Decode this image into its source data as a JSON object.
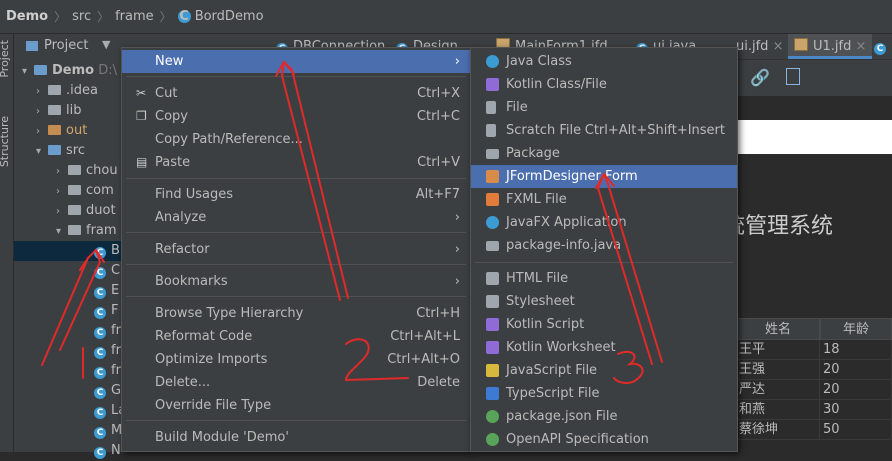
{
  "breadcrumb": {
    "items": [
      "Demo",
      "src",
      "frame",
      "BordDemo"
    ]
  },
  "toolstrip": {
    "project_label": "Project",
    "structure_label": "Structure"
  },
  "project_panel": {
    "title": "Project"
  },
  "tree": [
    {
      "label": "Demo",
      "suffix": "D:\\",
      "type": "module",
      "expanded": true
    },
    {
      "label": ".idea",
      "type": "folder",
      "expanded": false
    },
    {
      "label": "lib",
      "type": "folder",
      "expanded": false
    },
    {
      "label": "out",
      "type": "folder-excluded",
      "expanded": false
    },
    {
      "label": "src",
      "type": "folder-source",
      "expanded": true
    },
    {
      "label": "chou",
      "type": "package",
      "expanded": false
    },
    {
      "label": "com",
      "type": "package",
      "expanded": false
    },
    {
      "label": "duot",
      "type": "package",
      "expanded": false
    },
    {
      "label": "fram",
      "type": "package",
      "expanded": true
    },
    {
      "label": "B",
      "type": "class",
      "selected": true
    },
    {
      "label": "C",
      "type": "class"
    },
    {
      "label": "E",
      "type": "class"
    },
    {
      "label": "F",
      "type": "class"
    },
    {
      "label": "fr",
      "type": "class"
    },
    {
      "label": "fr",
      "type": "class"
    },
    {
      "label": "fr",
      "type": "class"
    },
    {
      "label": "G",
      "type": "class"
    },
    {
      "label": "La",
      "type": "class"
    },
    {
      "label": "M",
      "type": "class"
    },
    {
      "label": "N",
      "type": "class"
    }
  ],
  "tabs": [
    {
      "label": "DBConnection",
      "active": false
    },
    {
      "label": "Design",
      "active": false
    },
    {
      "label": "MainForm1.jfd",
      "active": false
    },
    {
      "label": "ui.java",
      "active": false
    },
    {
      "label": "ui.jfd",
      "active": false
    },
    {
      "label": "U1.jfd",
      "active": true
    }
  ],
  "context_menu": {
    "items": [
      {
        "label": "New",
        "shortcut": "",
        "submenu": true,
        "selected": true,
        "icon": ""
      },
      {
        "separator": true
      },
      {
        "label": "Cut",
        "shortcut": "Ctrl+X",
        "icon": "scissors-icon"
      },
      {
        "label": "Copy",
        "shortcut": "Ctrl+C",
        "icon": "copy-icon"
      },
      {
        "label": "Copy Path/Reference...",
        "shortcut": "",
        "icon": ""
      },
      {
        "label": "Paste",
        "shortcut": "Ctrl+V",
        "icon": "paste-icon"
      },
      {
        "separator": true
      },
      {
        "label": "Find Usages",
        "shortcut": "Alt+F7",
        "icon": ""
      },
      {
        "label": "Analyze",
        "shortcut": "",
        "submenu": true,
        "icon": ""
      },
      {
        "separator": true
      },
      {
        "label": "Refactor",
        "shortcut": "",
        "submenu": true,
        "icon": ""
      },
      {
        "separator": true
      },
      {
        "label": "Bookmarks",
        "shortcut": "",
        "submenu": true,
        "icon": ""
      },
      {
        "separator": true
      },
      {
        "label": "Browse Type Hierarchy",
        "shortcut": "Ctrl+H",
        "icon": ""
      },
      {
        "label": "Reformat Code",
        "shortcut": "Ctrl+Alt+L",
        "icon": ""
      },
      {
        "label": "Optimize Imports",
        "shortcut": "Ctrl+Alt+O",
        "icon": ""
      },
      {
        "label": "Delete...",
        "shortcut": "Delete",
        "icon": ""
      },
      {
        "label": "Override File Type",
        "shortcut": "",
        "icon": ""
      },
      {
        "separator": true
      },
      {
        "label": "Build Module 'Demo'",
        "shortcut": "",
        "icon": ""
      }
    ]
  },
  "new_submenu": {
    "items": [
      {
        "label": "Java Class",
        "shortcut": "",
        "icon": "java-class-icon",
        "color": "#3d9bd3"
      },
      {
        "label": "Kotlin Class/File",
        "shortcut": "",
        "icon": "kotlin-icon",
        "color": "#8e6bd6"
      },
      {
        "label": "File",
        "shortcut": "",
        "icon": "file-icon",
        "color": "#a0a6ae"
      },
      {
        "label": "Scratch File",
        "shortcut": "Ctrl+Alt+Shift+Insert",
        "icon": "scratch-file-icon",
        "color": "#a0a6ae"
      },
      {
        "label": "Package",
        "shortcut": "",
        "icon": "package-icon",
        "color": "#a0a6ae"
      },
      {
        "label": "JFormDesigner Form",
        "shortcut": "",
        "icon": "jformdesigner-icon",
        "color": "#d98c4a",
        "selected": true
      },
      {
        "label": "FXML File",
        "shortcut": "",
        "icon": "fxml-icon",
        "color": "#e07b39"
      },
      {
        "label": "JavaFX Application",
        "shortcut": "",
        "icon": "javafx-icon",
        "color": "#3d9bd3"
      },
      {
        "label": "package-info.java",
        "shortcut": "",
        "icon": "package-info-icon",
        "color": "#a0a6ae"
      },
      {
        "separator": true
      },
      {
        "label": "HTML File",
        "shortcut": "",
        "icon": "html-icon",
        "color": "#a0a6ae"
      },
      {
        "label": "Stylesheet",
        "shortcut": "",
        "icon": "stylesheet-icon",
        "color": "#a0a6ae"
      },
      {
        "label": "Kotlin Script",
        "shortcut": "",
        "icon": "kotlin-script-icon",
        "color": "#8e6bd6"
      },
      {
        "label": "Kotlin Worksheet",
        "shortcut": "",
        "icon": "kotlin-worksheet-icon",
        "color": "#8e6bd6"
      },
      {
        "label": "JavaScript File",
        "shortcut": "",
        "icon": "javascript-icon",
        "color": "#d6b93d"
      },
      {
        "label": "TypeScript File",
        "shortcut": "",
        "icon": "typescript-icon",
        "color": "#3d7ad3"
      },
      {
        "label": "package.json File",
        "shortcut": "",
        "icon": "package-json-icon",
        "color": "#5aa45a"
      },
      {
        "label": "OpenAPI Specification",
        "shortcut": "",
        "icon": "openapi-icon",
        "color": "#5aa45a"
      }
    ]
  },
  "form_preview": {
    "title": "统管理系统",
    "table": {
      "headers": [
        "姓名",
        "年龄"
      ],
      "rows": [
        [
          "王平",
          "18"
        ],
        [
          "王强",
          "20"
        ],
        [
          "严达",
          "20"
        ],
        [
          "和燕",
          "30"
        ],
        [
          "蔡徐坤",
          "50"
        ]
      ]
    }
  },
  "annotations": {
    "label_1": "1",
    "label_2": "2",
    "label_3": "3"
  },
  "colors": {
    "selection": "#4b6eaf",
    "annotation": "#e02a2a",
    "background": "#2b2b2b",
    "panel": "#3c3f41"
  }
}
